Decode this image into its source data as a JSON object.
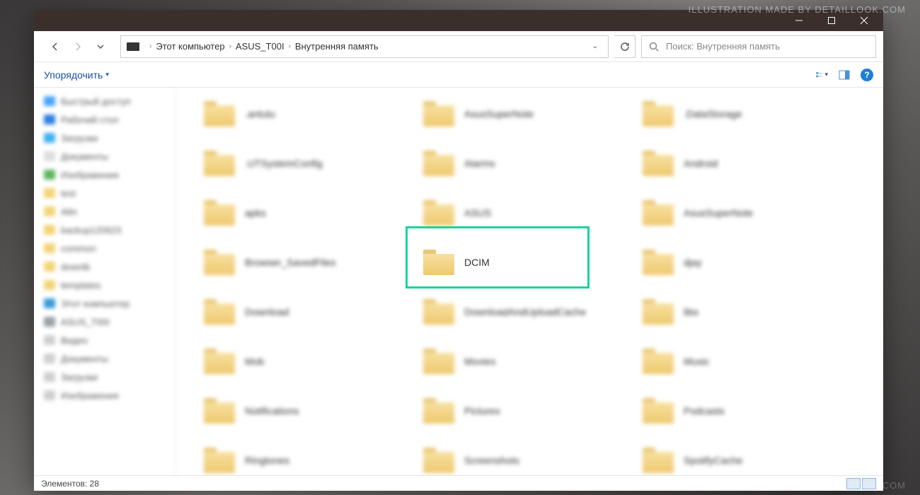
{
  "watermark": "ILLUSTRATION MADE BY DETAILLOOK.COM",
  "titlebar": {
    "min": "min",
    "max": "max",
    "close": "close"
  },
  "addr": {
    "crumbs": [
      "Этот компьютер",
      "ASUS_T00I",
      "Внутренняя память"
    ]
  },
  "search": {
    "placeholder": "Поиск: Внутренняя память"
  },
  "toolbar": {
    "organize": "Упорядочить"
  },
  "sidebar": [
    {
      "label": "Быстрый доступ",
      "color": "#4aa3ff"
    },
    {
      "label": "Рабочий стол",
      "color": "#2f7fe0"
    },
    {
      "label": "Загрузки",
      "color": "#41b1ef"
    },
    {
      "label": "Документы",
      "color": "#dcdcdc"
    },
    {
      "label": "Изображения",
      "color": "#5fb45f"
    },
    {
      "label": "test",
      "color": "#f3d477"
    },
    {
      "label": "Attn",
      "color": "#f3d477"
    },
    {
      "label": "backup120623",
      "color": "#f3d477"
    },
    {
      "label": "common",
      "color": "#f3d477"
    },
    {
      "label": "downlb",
      "color": "#f3d477"
    },
    {
      "label": "templates",
      "color": "#f3d477"
    },
    {
      "label": "Этот компьютер",
      "color": "#3a9bd8"
    },
    {
      "label": "ASUS_T00I",
      "color": "#9aa0a6"
    },
    {
      "label": "Видео",
      "color": "#cfcfcf"
    },
    {
      "label": "Документы",
      "color": "#cfcfcf"
    },
    {
      "label": "Загрузки",
      "color": "#cfcfcf"
    },
    {
      "label": "Изображения",
      "color": "#cfcfcf"
    }
  ],
  "folders": [
    ".antutu",
    "AsusSuperNote",
    ".DataStorage",
    ".UTSystemConfig",
    "Alarms",
    "Android",
    "apks",
    "ASUS",
    "AsusSuperNote",
    "Browser_SavedFiles",
    "DCIM",
    "djay",
    "Download",
    "DownloadAndUploadCache",
    "libs",
    "Mob",
    "Movies",
    "Music",
    "Notifications",
    "Pictures",
    "Podcasts",
    "Ringtones",
    "Screenshots",
    "SpotifyCache"
  ],
  "sharp_index": 10,
  "status": {
    "text": "Элементов: 28"
  }
}
